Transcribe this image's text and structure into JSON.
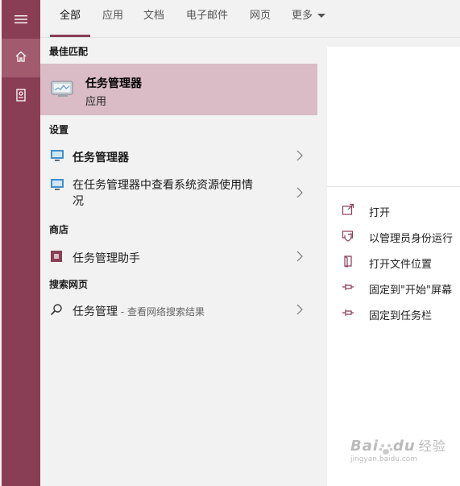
{
  "sidebar": {
    "items": [
      {
        "icon": "hamburger-menu-icon"
      },
      {
        "icon": "home-icon"
      },
      {
        "icon": "notebook-icon"
      }
    ]
  },
  "tabs": [
    {
      "label": "全部",
      "active": true
    },
    {
      "label": "应用"
    },
    {
      "label": "文档"
    },
    {
      "label": "电子邮件"
    },
    {
      "label": "网页"
    },
    {
      "label": "更多"
    }
  ],
  "results": {
    "best_match": {
      "header": "最佳匹配",
      "title": "任务管理器",
      "subtitle": "应用"
    },
    "settings": {
      "header": "设置",
      "items": [
        "任务管理器",
        "在任务管理器中查看系统资源使用情",
        "况"
      ]
    },
    "store": {
      "header": "商店",
      "item": "任务管理助手"
    },
    "web": {
      "header": "搜索网页",
      "query": "任务管理",
      "hint": " - 查看网络搜索结果"
    }
  },
  "preview": {
    "actions": [
      {
        "label": "打开",
        "icon": "open-icon"
      },
      {
        "label": "以管理员身份运行",
        "icon": "shield-icon"
      },
      {
        "label": "打开文件位置",
        "icon": "file-location-icon"
      },
      {
        "label": "固定到\"开始\"屏幕",
        "icon": "pin-icon"
      },
      {
        "label": "固定到任务栏",
        "icon": "pin-icon"
      }
    ]
  },
  "watermark": {
    "text": "Bai",
    "text2": "du",
    "text3": "经验",
    "url": "jingyan.baidu.com"
  },
  "colors": {
    "accent": "#8a3e55",
    "highlight": "#d9bcc6"
  }
}
